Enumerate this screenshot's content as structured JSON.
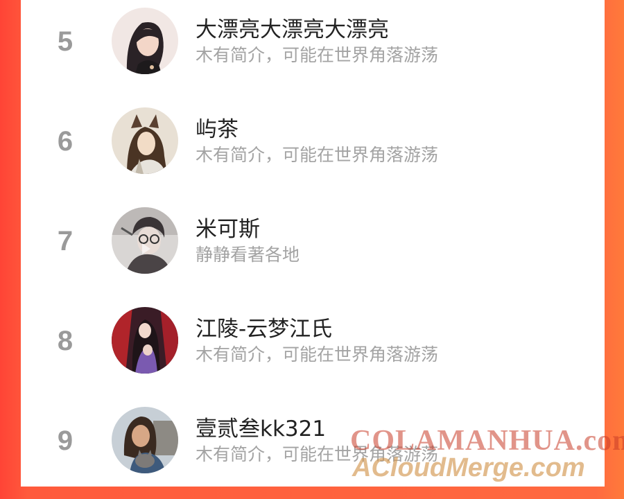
{
  "list": [
    {
      "rank": "5",
      "name": "大漂亮大漂亮大漂亮",
      "bio": "木有简介，可能在世界角落游荡",
      "avatar_icon": "avatar-girl-icon"
    },
    {
      "rank": "6",
      "name": "屿茶",
      "bio": "木有简介，可能在世界角落游荡",
      "avatar_icon": "avatar-anime-fox-icon"
    },
    {
      "rank": "7",
      "name": "米可斯",
      "bio": "静静看著各地",
      "avatar_icon": "avatar-glasses-boy-icon"
    },
    {
      "rank": "8",
      "name": "江陵-云梦江氏",
      "bio": "木有简介，可能在世界角落游荡",
      "avatar_icon": "avatar-anime-pair-icon"
    },
    {
      "rank": "9",
      "name": "壹贰叁kk321",
      "bio": "木有简介，可能在世界角落游荡",
      "avatar_icon": "avatar-woman-cat-icon"
    }
  ],
  "watermark": {
    "line1": "COLAMANHUA.com",
    "line2": "ACloudMerge.com"
  },
  "colors": {
    "background": "#ff5a3c",
    "rank": "#9a9a9a",
    "name": "#222222",
    "bio": "#a3a3a3"
  }
}
